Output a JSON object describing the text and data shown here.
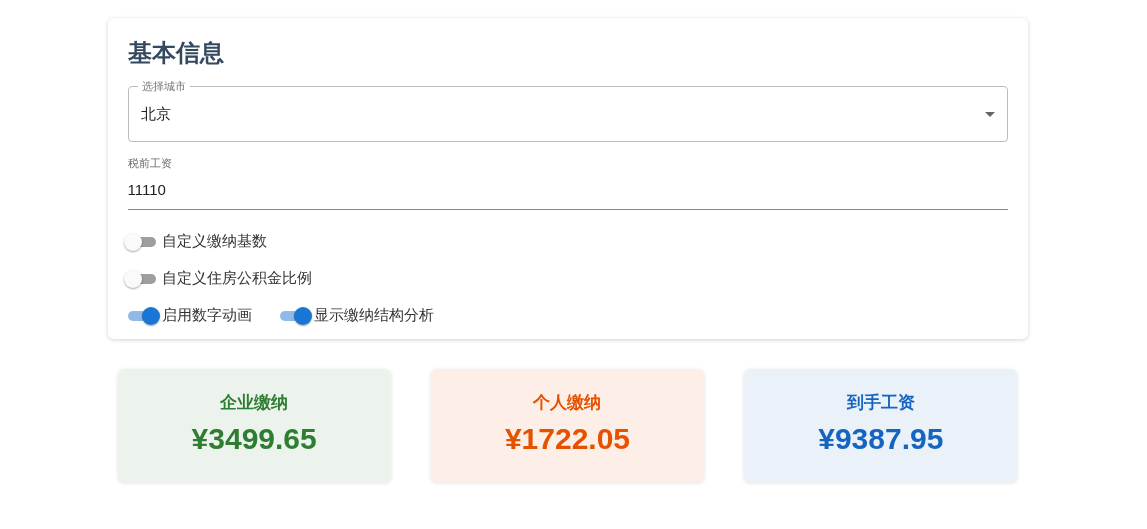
{
  "basic_info": {
    "title": "基本信息",
    "city_select": {
      "label": "选择城市",
      "value": "北京"
    },
    "salary_field": {
      "label": "税前工资",
      "value": "11110"
    },
    "switch_rows": [
      [
        {
          "label": "自定义缴纳基数",
          "on": false
        }
      ],
      [
        {
          "label": "自定义住房公积金比例",
          "on": false
        }
      ],
      [
        {
          "label": "启用数字动画",
          "on": true
        },
        {
          "label": "显示缴纳结构分析",
          "on": true
        }
      ]
    ]
  },
  "summary_cards": [
    {
      "label": "企业缴纳",
      "amount": "¥3499.65",
      "color": "#2e7d32"
    },
    {
      "label": "个人缴纳",
      "amount": "¥1722.05",
      "color": "#e65100"
    },
    {
      "label": "到手工资",
      "amount": "¥9387.95",
      "color": "#1565c0"
    }
  ]
}
